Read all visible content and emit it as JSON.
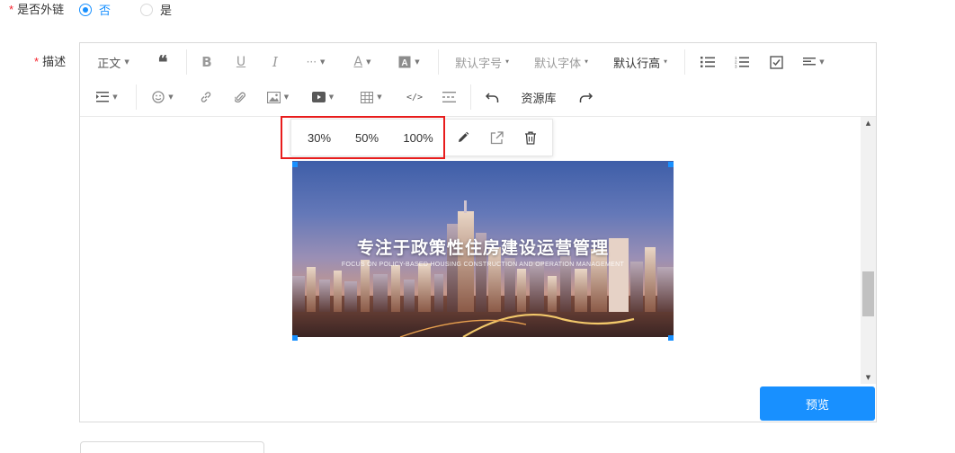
{
  "form": {
    "external_link": {
      "label": "是否外链",
      "options": [
        {
          "label": "否",
          "checked": true
        },
        {
          "label": "是",
          "checked": false
        }
      ]
    },
    "description": {
      "label": "描述"
    }
  },
  "toolbar": {
    "row1": {
      "paragraph": "正文",
      "font_size": "默认字号",
      "font_family": "默认字体",
      "line_height": "默认行高"
    },
    "row2": {
      "resource_library": "资源库"
    },
    "icons": [
      "quote-icon",
      "bold-icon",
      "underline-icon",
      "italic-icon",
      "more-icon",
      "font-color-icon",
      "background-color-icon",
      "bulleted-list-icon",
      "numbered-list-icon",
      "todo-icon",
      "align-icon",
      "indent-icon",
      "emoji-icon",
      "link-icon",
      "attachment-icon",
      "image-icon",
      "video-icon",
      "table-icon",
      "code-icon",
      "divider-icon",
      "undo-icon",
      "redo-icon"
    ]
  },
  "image_toolbar": {
    "sizes": [
      "30%",
      "50%",
      "100%"
    ],
    "icons": [
      "edit-icon",
      "open-link-icon",
      "delete-icon"
    ]
  },
  "image": {
    "title": "专注于政策性住房建设运营管理",
    "subtitle": "FOCUS ON POLICY-BASED HOUSING CONSTRUCTION AND OPERATION MANAGEMENT"
  },
  "actions": {
    "preview": "预览"
  },
  "colors": {
    "primary": "#1890ff",
    "required": "#f5222d",
    "highlight": "#e81c1c"
  }
}
